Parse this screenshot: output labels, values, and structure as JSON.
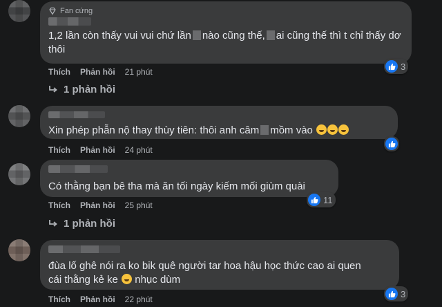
{
  "comments": [
    {
      "badge": "Fan cứng",
      "text_parts": [
        "1,2 lần còn thấy vui vui chứ lần",
        "nào cũng thế,",
        "ai cũng thế thì t chỉ thấy dơ thôi"
      ],
      "like_label": "Thích",
      "reply_label": "Phản hồi",
      "time": "21 phút",
      "reaction_count": "3",
      "replies": "1 phản hồi"
    },
    {
      "text_parts": [
        "Xin phép phẫn nộ thay thùy tiên: thôi anh câm",
        "mồm vào"
      ],
      "like_label": "Thích",
      "reply_label": "Phản hồi",
      "time": "24 phút"
    },
    {
      "text_parts": [
        "Có thằng bạn bê tha mà ăn tối ngày kiếm mối giùm quài"
      ],
      "like_label": "Thích",
      "reply_label": "Phản hồi",
      "time": "25 phút",
      "reaction_count": "11",
      "replies": "1 phản hồi"
    },
    {
      "text_parts": [
        "đùa lố ghê nói ra ko bik quê người tar hoa hậu học thức cao ai quen",
        "cái thằng kẻ ke",
        "nhục dùm"
      ],
      "like_label": "Thích",
      "reply_label": "Phản hồi",
      "time": "22 phút",
      "reaction_count": "3"
    }
  ],
  "colors": {
    "background": "#18191a",
    "bubble": "#3a3b3c",
    "text": "#e4e6eb",
    "muted": "#b0b3b8",
    "like": "#1877f2"
  },
  "icons": [
    "diamond-icon",
    "like-icon",
    "reply-arrow-icon",
    "laughing-emoji-icon"
  ]
}
